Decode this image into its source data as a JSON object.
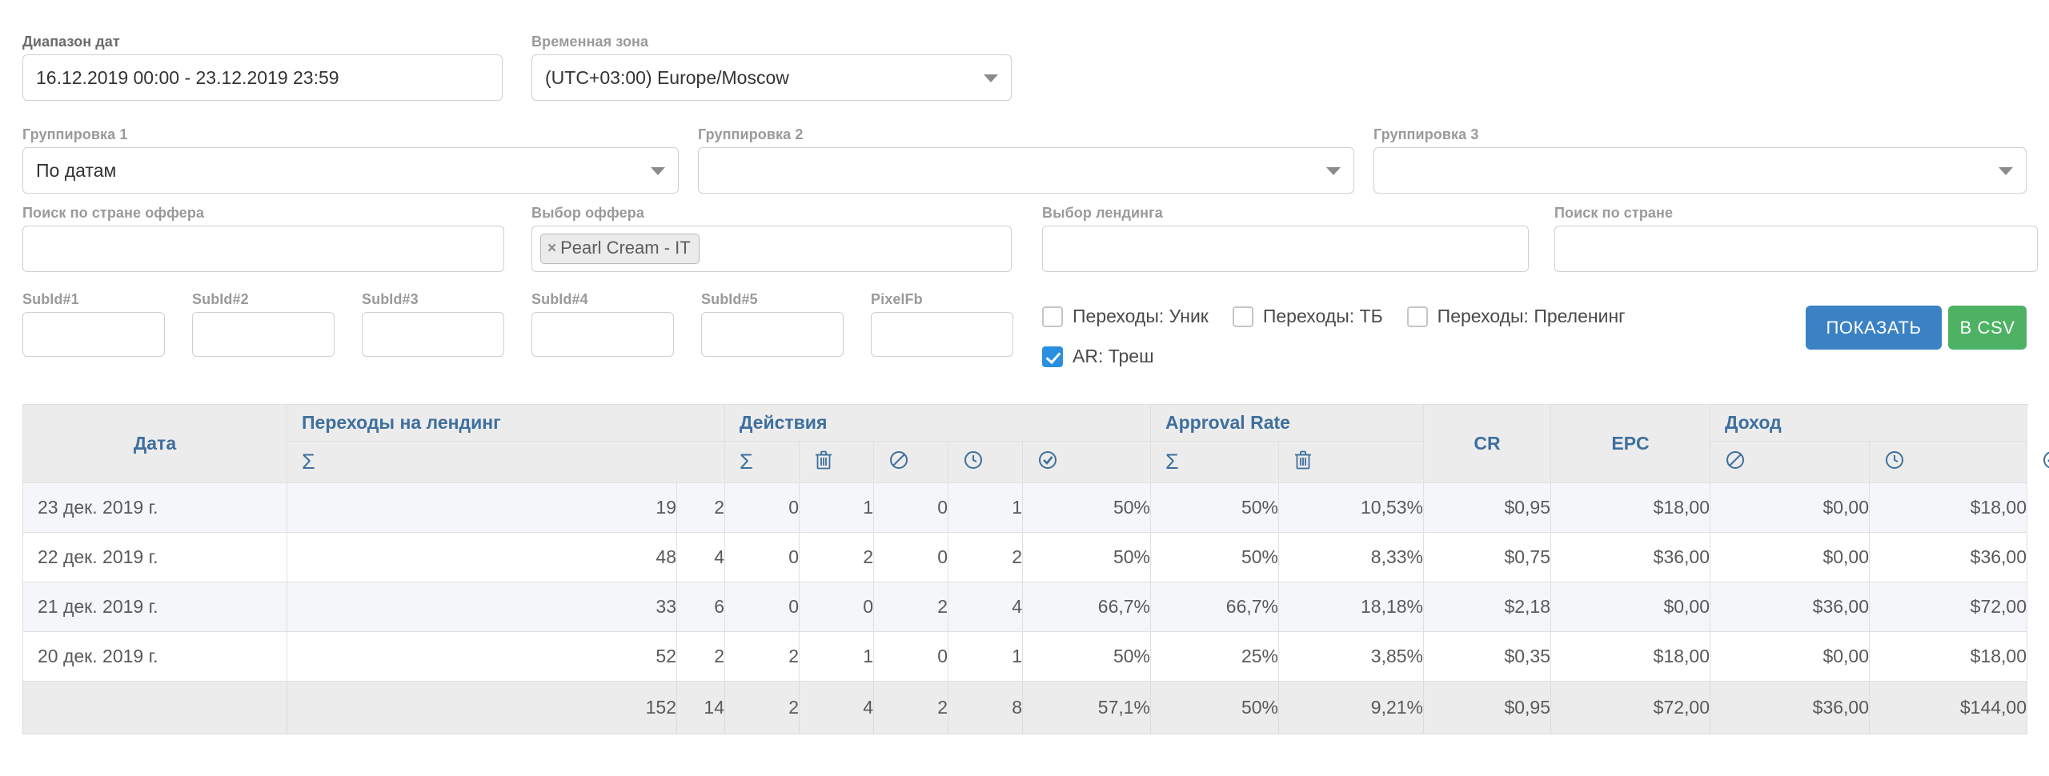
{
  "filters": {
    "date_range": {
      "label": "Диапазон дат",
      "value": "16.12.2019 00:00 - 23.12.2019 23:59"
    },
    "timezone": {
      "label": "Временная зона",
      "value": "(UTC+03:00) Europe/Moscow"
    },
    "grouping1": {
      "label": "Группировка 1",
      "value": "По датам"
    },
    "grouping2": {
      "label": "Группировка 2",
      "value": ""
    },
    "grouping3": {
      "label": "Группировка 3",
      "value": ""
    },
    "offer_country_search": {
      "label": "Поиск по стране оффера",
      "value": ""
    },
    "offer_select": {
      "label": "Выбор оффера",
      "chips": [
        "Pearl Cream - IT"
      ],
      "chip_remove": "×"
    },
    "landing_select": {
      "label": "Выбор лендинга",
      "value": ""
    },
    "country_search": {
      "label": "Поиск по стране",
      "value": ""
    },
    "subids": [
      {
        "label": "SubId#1",
        "value": ""
      },
      {
        "label": "SubId#2",
        "value": ""
      },
      {
        "label": "SubId#3",
        "value": ""
      },
      {
        "label": "SubId#4",
        "value": ""
      },
      {
        "label": "SubId#5",
        "value": ""
      },
      {
        "label": "PixelFb",
        "value": ""
      }
    ],
    "checkboxes": [
      {
        "label": "Переходы: Уник",
        "checked": false
      },
      {
        "label": "Переходы: ТБ",
        "checked": false
      },
      {
        "label": "Переходы: Преленинг",
        "checked": false
      },
      {
        "label": "AR: Треш",
        "checked": true
      }
    ],
    "buttons": {
      "show": "ПОКАЗАТЬ",
      "csv": "В CSV"
    }
  },
  "colors": {
    "primary": "#3b82c4",
    "success": "#4eb264",
    "header_text": "#3e6f9e",
    "header_bg": "#ececec",
    "checkbox_on": "#2a8fe0"
  },
  "table": {
    "group_headers": {
      "date": "Дата",
      "transitions": "Переходы на лендинг",
      "actions": "Действия",
      "approval_rate": "Approval Rate",
      "cr": "CR",
      "epc": "EPC",
      "income": "Доход"
    },
    "sub_headers": {
      "transitions_sum": "sigma-icon",
      "actions_sum": "sigma-icon",
      "actions_trash": "trash-icon",
      "actions_ban": "ban-icon",
      "actions_clock": "clock-icon",
      "actions_check": "check-circle-icon",
      "ar_sum": "sigma-icon",
      "ar_trash": "trash-icon",
      "income_ban": "ban-icon",
      "income_clock": "clock-icon",
      "income_check": "check-circle-icon"
    },
    "sigma_glyph": "Σ",
    "rows": [
      {
        "date": "23 дек. 2019 г.",
        "transitions": "19",
        "actions_sum": "2",
        "actions_trash": "0",
        "actions_ban": "1",
        "actions_clock": "0",
        "actions_check": "1",
        "ar_sum": "50%",
        "ar_trash": "50%",
        "cr": "10,53%",
        "epc": "$0,95",
        "income_ban": "$18,00",
        "income_clock": "$0,00",
        "income_check": "$18,00"
      },
      {
        "date": "22 дек. 2019 г.",
        "transitions": "48",
        "actions_sum": "4",
        "actions_trash": "0",
        "actions_ban": "2",
        "actions_clock": "0",
        "actions_check": "2",
        "ar_sum": "50%",
        "ar_trash": "50%",
        "cr": "8,33%",
        "epc": "$0,75",
        "income_ban": "$36,00",
        "income_clock": "$0,00",
        "income_check": "$36,00"
      },
      {
        "date": "21 дек. 2019 г.",
        "transitions": "33",
        "actions_sum": "6",
        "actions_trash": "0",
        "actions_ban": "0",
        "actions_clock": "2",
        "actions_check": "4",
        "ar_sum": "66,7%",
        "ar_trash": "66,7%",
        "cr": "18,18%",
        "epc": "$2,18",
        "income_ban": "$0,00",
        "income_clock": "$36,00",
        "income_check": "$72,00"
      },
      {
        "date": "20 дек. 2019 г.",
        "transitions": "52",
        "actions_sum": "2",
        "actions_trash": "2",
        "actions_ban": "1",
        "actions_clock": "0",
        "actions_check": "1",
        "ar_sum": "50%",
        "ar_trash": "25%",
        "cr": "3,85%",
        "epc": "$0,35",
        "income_ban": "$18,00",
        "income_clock": "$0,00",
        "income_check": "$18,00"
      }
    ],
    "total": {
      "date": "",
      "transitions": "152",
      "actions_sum": "14",
      "actions_trash": "2",
      "actions_ban": "4",
      "actions_clock": "2",
      "actions_check": "8",
      "ar_sum": "57,1%",
      "ar_trash": "50%",
      "cr": "9,21%",
      "epc": "$0,95",
      "income_ban": "$72,00",
      "income_clock": "$36,00",
      "income_check": "$144,00"
    }
  }
}
